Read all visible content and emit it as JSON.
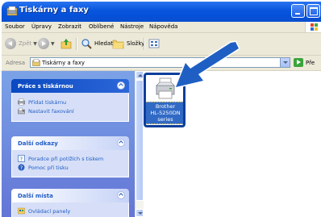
{
  "window": {
    "title": "Tiskárny a faxy"
  },
  "menu": {
    "items": [
      "Soubor",
      "Úpravy",
      "Zobrazit",
      "Oblíbené",
      "Nástroje",
      "Nápověda"
    ]
  },
  "toolbar": {
    "back_label": "Zpět",
    "search_label": "Hledat",
    "folders_label": "Složky"
  },
  "address": {
    "label": "Adresa",
    "value": "Tiskárny a faxy",
    "go_label": "Pře"
  },
  "tasks": {
    "printer_tasks": {
      "title": "Práce s tiskárnou",
      "items": [
        "Přidat tiskárnu",
        "Nastavit faxování"
      ]
    },
    "see_also": {
      "title": "Další odkazy",
      "items": [
        "Poradce při potížích s tiskem",
        "Pomoc při tisku"
      ]
    },
    "other_places": {
      "title": "Další místa",
      "items": [
        "Ovládací panely"
      ]
    }
  },
  "printers": [
    {
      "name_line1": "Brother",
      "name_line2": "HL-5250DN",
      "name_line3": "series"
    }
  ],
  "colors": {
    "titlebar": "#0550d8",
    "leftpane": "#7ba2e7",
    "selection": "#316ac5",
    "callout": "#0b3f9a"
  },
  "icons": [
    "printer-folder-icon",
    "back-icon",
    "forward-icon",
    "up-folder-icon",
    "search-icon",
    "folders-icon",
    "views-icon",
    "add-printer-icon",
    "fax-icon",
    "troubleshoot-icon",
    "help-icon",
    "control-panel-icon",
    "printer-icon",
    "go-icon",
    "callout-arrow-icon"
  ]
}
